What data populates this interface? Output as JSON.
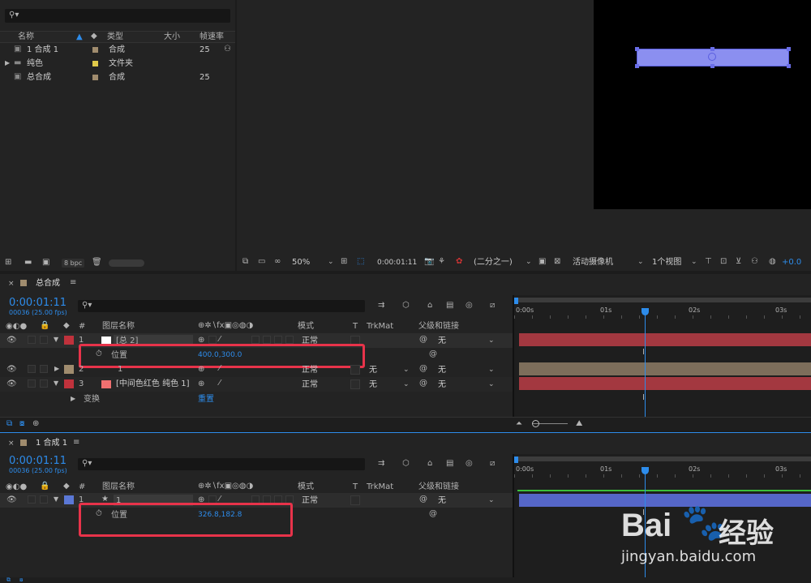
{
  "project": {
    "search_placeholder": "",
    "columns": {
      "name": "名称",
      "type": "类型",
      "size": "大小",
      "fps": "帧速率"
    },
    "items": [
      {
        "name": "1 合成 1",
        "type": "合成",
        "fps": "25",
        "color": "#a08c6e"
      },
      {
        "name": "纯色",
        "type": "文件夹",
        "fps": "",
        "color": "#e0c94a"
      },
      {
        "name": "总合成",
        "type": "合成",
        "fps": "25",
        "color": "#a08c6e"
      }
    ],
    "bpc": "8 bpc"
  },
  "viewer": {
    "zoom": "50%",
    "timecode": "0:00:01:11",
    "resolution": "(二分之一)",
    "camera": "活动摄像机",
    "views": "1个视图",
    "exposure": "+0.0"
  },
  "timelines": [
    {
      "tab": "总合成",
      "timecode": "0:00:01:11",
      "frames": "00036 (25.00 fps)",
      "headers": {
        "layer_name": "图层名称",
        "mode": "模式",
        "t": "T",
        "trkmat": "TrkMat",
        "parent": "父级和链接",
        "num": "#"
      },
      "ruler": [
        "0:00s",
        "01s",
        "02s",
        "03s"
      ],
      "rows": [
        {
          "num": "1",
          "name": "[总 2]",
          "label_color": "#c0323c",
          "mode": "正常",
          "trkmat": "",
          "parent": "无",
          "bar_color": "#a33840"
        },
        {
          "prop": "位置",
          "value": "400.0,300.0"
        },
        {
          "num": "2",
          "name": "1",
          "label_color": "#a08c6e",
          "mode": "正常",
          "trkmat": "无",
          "parent": "无",
          "bar_color": "#7d6e5b"
        },
        {
          "num": "3",
          "name": "[中间色红色 纯色 1]",
          "label_color": "#c0323c",
          "mode": "正常",
          "trkmat": "无",
          "parent": "无",
          "bar_color": "#a33840"
        },
        {
          "prop": "变换",
          "value": "重置"
        }
      ]
    },
    {
      "tab": "1 合成 1",
      "timecode": "0:00:01:11",
      "frames": "00036 (25.00 fps)",
      "headers": {
        "layer_name": "图层名称",
        "mode": "模式",
        "t": "T",
        "trkmat": "TrkMat",
        "parent": "父级和链接",
        "num": "#"
      },
      "ruler": [
        "0:00s",
        "01s",
        "02s",
        "03s"
      ],
      "rows": [
        {
          "num": "1",
          "name": "1",
          "label_color": "#5b78d6",
          "mode": "正常",
          "trkmat": "",
          "parent": "无",
          "bar_color": "#5566c8"
        },
        {
          "prop": "位置",
          "value": "326.8,182.8"
        }
      ]
    }
  ],
  "watermark": {
    "brand": "Bai",
    "brand2": "经验",
    "url": "jingyan.baidu.com"
  }
}
